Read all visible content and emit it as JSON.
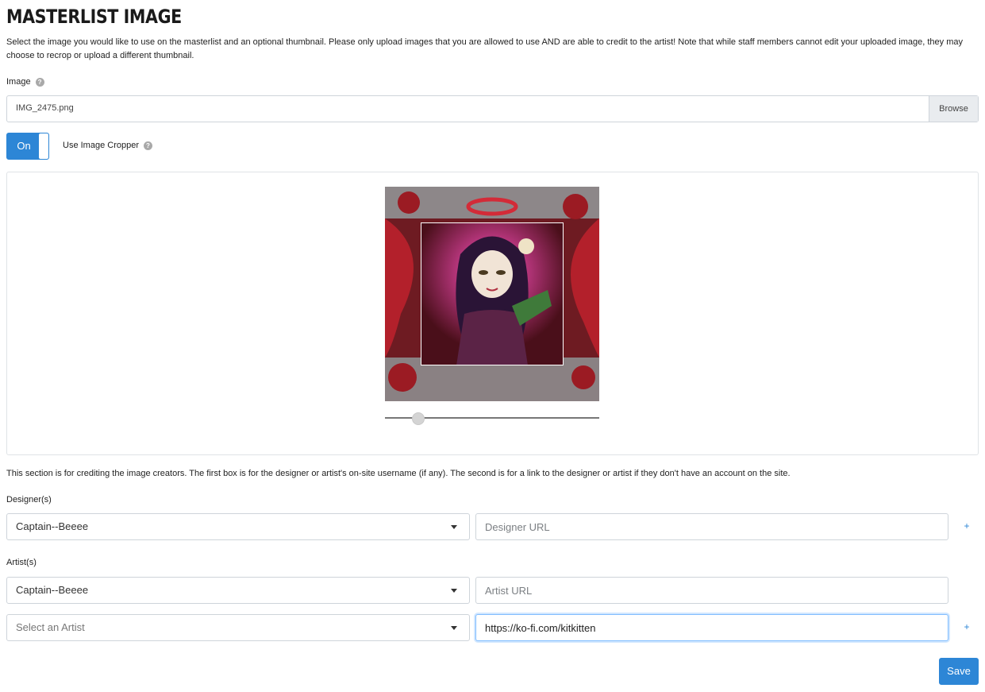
{
  "page": {
    "title": "MASTERLIST IMAGE",
    "intro": "Select the image you would like to use on the masterlist and an optional thumbnail. Please only upload images that you are allowed to use AND are able to credit to the artist! Note that while staff members cannot edit your uploaded image, they may choose to recrop or upload a different thumbnail."
  },
  "image_field": {
    "label": "Image",
    "help_icon": "?",
    "file_name": "IMG_2475.png",
    "browse_label": "Browse"
  },
  "cropper": {
    "toggle_label": "On",
    "toggle_state": "on",
    "label": "Use Image Cropper",
    "help_icon": "?",
    "zoom_level": 0.15
  },
  "credits": {
    "note": "This section is for crediting the image creators. The first box is for the designer or artist's on-site username (if any). The second is for a link to the designer or artist if they don't have an account on the site.",
    "designers_label": "Designer(s)",
    "designers": [
      {
        "username": "Captain--Beeee",
        "url": "",
        "url_placeholder": "Designer URL"
      }
    ],
    "artists_label": "Artist(s)",
    "artists": [
      {
        "username": "Captain--Beeee",
        "url": "",
        "url_placeholder": "Artist URL"
      },
      {
        "username": "",
        "username_placeholder": "Select an Artist",
        "url": "https://ko-fi.com/kitkitten",
        "url_placeholder": "Artist URL"
      }
    ],
    "add_label": "+"
  },
  "actions": {
    "save_label": "Save"
  },
  "colors": {
    "primary": "#2d86d6",
    "border": "#ced4da"
  }
}
